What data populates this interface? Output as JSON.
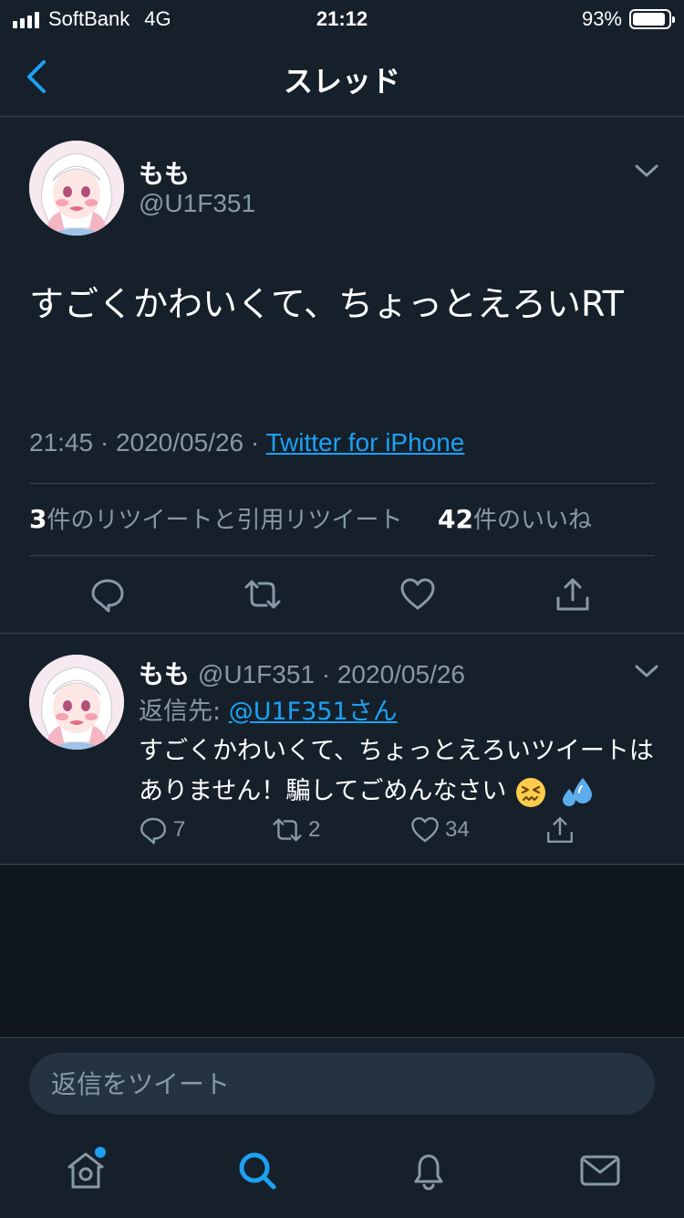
{
  "status_bar": {
    "carrier": "SoftBank",
    "network": "4G",
    "time": "21:12",
    "battery": "93%",
    "battery_level": 0.93
  },
  "nav": {
    "title": "スレッド",
    "back_icon": "chevron-left-icon"
  },
  "main_tweet": {
    "name": "もも",
    "handle": "@U1F351",
    "text": "すごくかわいくて、ちょっとえろいRT",
    "time": "21:45",
    "date": "2020/05/26",
    "source": "Twitter for iPhone",
    "retweet_count": "3",
    "retweet_label": "件のリツイートと引用リツイート",
    "like_count": "42",
    "like_label": "件のいいね",
    "actions": [
      "reply-icon",
      "retweet-icon",
      "heart-icon",
      "share-icon"
    ]
  },
  "reply_tweet": {
    "name": "もも",
    "handle": "@U1F351",
    "date": "2020/05/26",
    "reply_to_label": "返信先: ",
    "reply_to_handle": "@U1F351さん",
    "text": "すごくかわいくて、ちょっとえろいツイートはありません！騙してごめんなさい",
    "emojis": [
      "confounded-face-emoji",
      "sweat-droplets-emoji"
    ],
    "reply_count": "7",
    "retweet_count": "2",
    "like_count": "34"
  },
  "compose": {
    "placeholder": "返信をツイート"
  },
  "tab_bar": {
    "items": [
      "home-icon",
      "search-icon",
      "notifications-icon",
      "messages-icon"
    ],
    "active": "search-icon"
  },
  "colors": {
    "background": "#15202b",
    "accent": "#1da1f2",
    "secondary_text": "#8899a6",
    "divider": "#38444d"
  }
}
